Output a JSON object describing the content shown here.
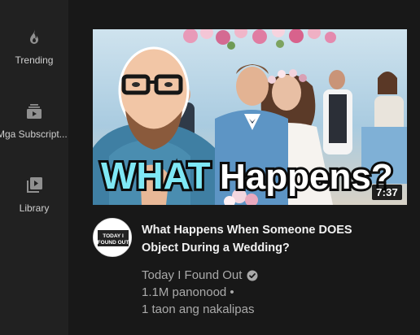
{
  "sidebar": {
    "items": [
      {
        "label": "Trending",
        "icon": "flame-icon"
      },
      {
        "label": "Mga Subscript...",
        "icon": "subscriptions-icon"
      },
      {
        "label": "Library",
        "icon": "library-icon"
      }
    ]
  },
  "video": {
    "thumbnail_text": {
      "word1": "WHAT",
      "word2": "Happens?"
    },
    "duration": "7:37",
    "title_line1": "What Happens When Someone DOES",
    "title_line2": "Object During a Wedding?",
    "channel": "Today I Found Out",
    "channel_logo_text": {
      "line1": "TODAY I",
      "line2": "FOUND OUT"
    },
    "views": "1.1M panonood •",
    "age": "1 taon ang nakalipas"
  },
  "colors": {
    "background": "#181818",
    "sidebar": "#212121",
    "meta_text": "#aaaaaa",
    "thumb_word1": "#7fe8f5"
  }
}
